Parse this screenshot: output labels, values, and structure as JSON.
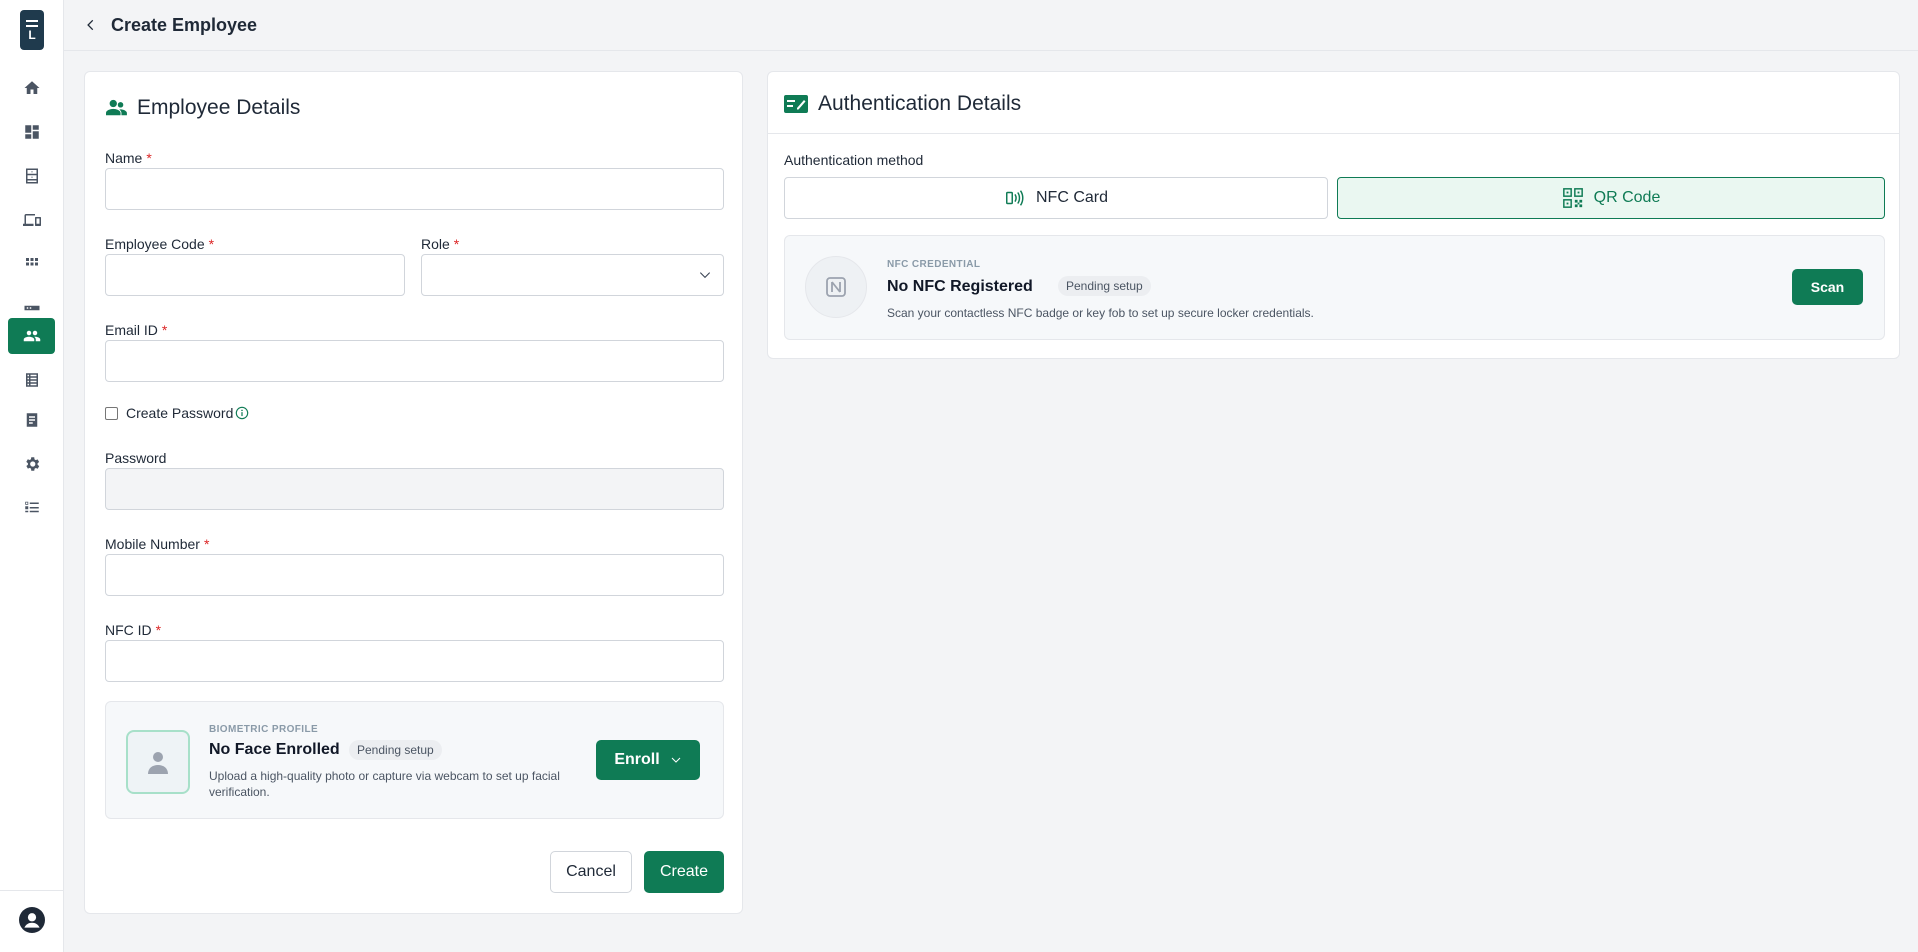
{
  "header": {
    "title": "Create Employee"
  },
  "sidebar": {
    "items": [
      {
        "name": "home",
        "icon": "home-icon"
      },
      {
        "name": "dashboard",
        "icon": "dashboard-icon"
      },
      {
        "name": "lockers",
        "icon": "cabinet-icon"
      },
      {
        "name": "devices",
        "icon": "devices-icon"
      },
      {
        "name": "apps",
        "icon": "grid-icon"
      },
      {
        "name": "hardware",
        "icon": "rack-icon"
      },
      {
        "name": "employees",
        "icon": "people-icon",
        "active": true
      },
      {
        "name": "logs",
        "icon": "list-icon"
      },
      {
        "name": "reports",
        "icon": "document-icon"
      },
      {
        "name": "settings",
        "icon": "gear-icon"
      },
      {
        "name": "tasks",
        "icon": "checklist-icon"
      }
    ]
  },
  "employee": {
    "title": "Employee Details",
    "name_label": "Name",
    "code_label": "Employee Code",
    "role_label": "Role",
    "email_label": "Email ID",
    "create_password_label": "Create Password",
    "password_label": "Password",
    "mobile_label": "Mobile Number",
    "nfc_id_label": "NFC ID",
    "required_mark": "*",
    "biometric": {
      "eyebrow": "BIOMETRIC PROFILE",
      "title": "No Face Enrolled",
      "badge": "Pending setup",
      "desc": "Upload a high-quality photo or capture via webcam to set up facial verification.",
      "enroll_label": "Enroll"
    },
    "cancel_label": "Cancel",
    "create_label": "Create"
  },
  "auth": {
    "title": "Authentication Details",
    "method_label": "Authentication method",
    "nfc_option": "NFC Card",
    "qr_option": "QR Code",
    "selected": "QR Code",
    "nfc_credential": {
      "eyebrow": "NFC CREDENTIAL",
      "title": "No NFC Registered",
      "badge": "Pending setup",
      "desc": "Scan your contactless NFC badge or key fob to set up secure locker credentials.",
      "scan_label": "Scan"
    }
  },
  "colors": {
    "brand": "#0f7b55",
    "required": "#dc2626"
  }
}
